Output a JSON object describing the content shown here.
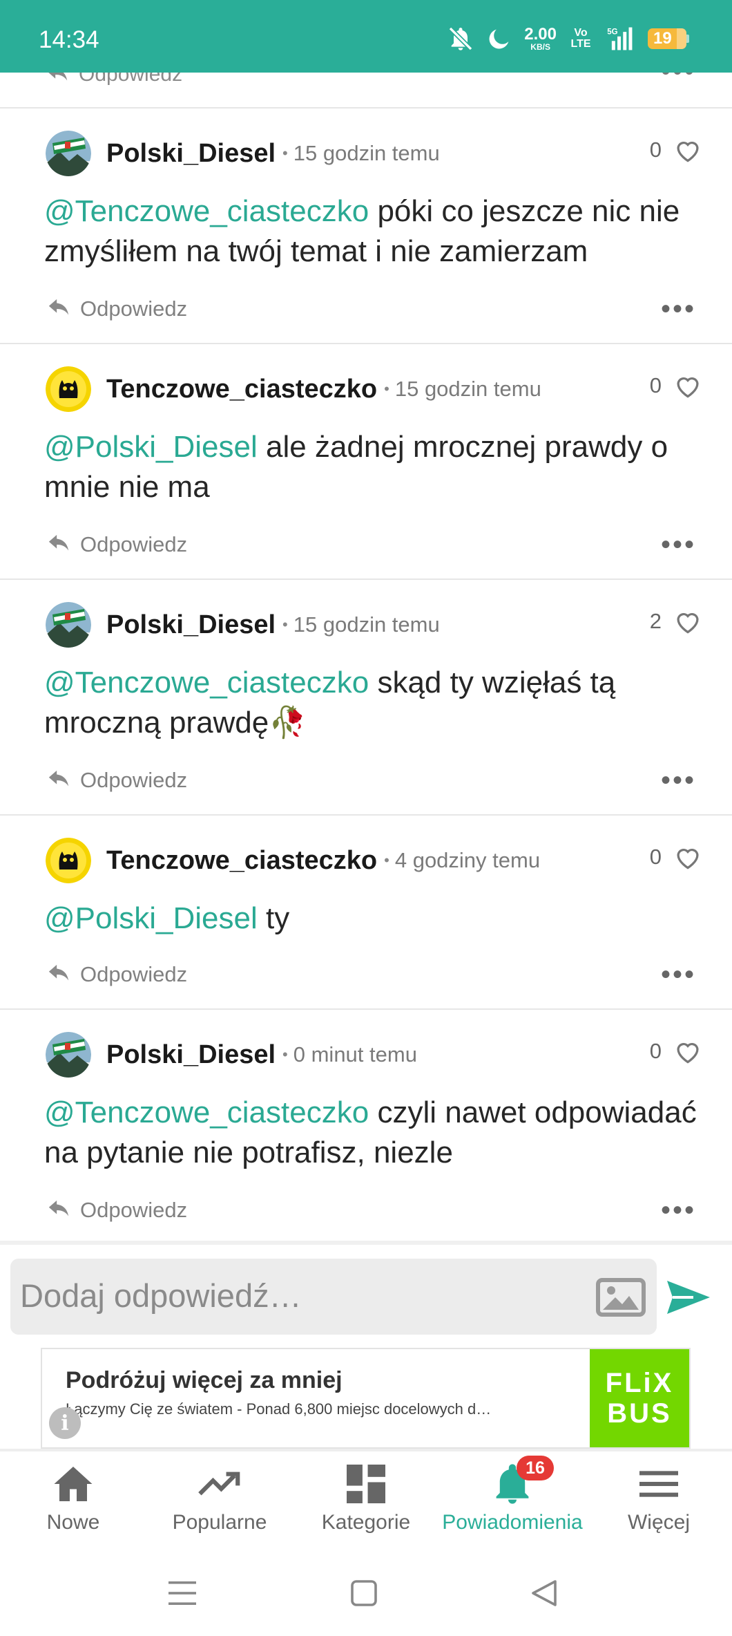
{
  "status_bar": {
    "time": "14:34",
    "net_speed": "2.00",
    "net_unit": "KB/S",
    "volte": "Vo LTE",
    "network": "5G",
    "battery": "19",
    "icons": [
      "bell-muted-icon",
      "moon-icon",
      "signal-icon",
      "battery-icon"
    ]
  },
  "previous_comment": {
    "reply_label": "Odpowiedz"
  },
  "comments": [
    {
      "author": "Polski_Diesel",
      "time": "15 godzin temu",
      "likes": "0",
      "mention": "@Tenczowe_ciasteczko",
      "text": " póki co jeszcze nic nie zmyśliłem na twój temat i nie zamierzam",
      "reply_label": "Odpowiedz",
      "avatar": "scarf-avatar"
    },
    {
      "author": "Tenczowe_ciasteczko",
      "time": "15 godzin temu",
      "likes": "0",
      "mention": "@Polski_Diesel",
      "text": " ale żadnej mrocznej prawdy o mnie nie ma",
      "reply_label": "Odpowiedz",
      "avatar": "cat-avatar"
    },
    {
      "author": "Polski_Diesel",
      "time": "15 godzin temu",
      "likes": "2",
      "mention": "@Tenczowe_ciasteczko",
      "text": " skąd ty wzięłaś tą mroczną prawdę🥀",
      "reply_label": "Odpowiedz",
      "avatar": "scarf-avatar"
    },
    {
      "author": "Tenczowe_ciasteczko",
      "time": "4 godziny temu",
      "likes": "0",
      "mention": "@Polski_Diesel",
      "text": " ty",
      "reply_label": "Odpowiedz",
      "avatar": "cat-avatar"
    },
    {
      "author": "Polski_Diesel",
      "time": "0 minut temu",
      "likes": "0",
      "mention": "@Tenczowe_ciasteczko",
      "text": " czyli nawet odpowiadać na pytanie nie potrafisz, niezle",
      "reply_label": "Odpowiedz",
      "avatar": "scarf-avatar"
    }
  ],
  "composer": {
    "placeholder": "Dodaj odpowiedź…"
  },
  "ad": {
    "title": "Podróżuj więcej za mniej",
    "description": "Łączymy Cię ze światem - Ponad 6,800 miejsc docelowych d…",
    "logo_line1": "FLiX",
    "logo_line2": "BUS",
    "logo_color": "#73d700"
  },
  "bottom_nav": {
    "items": [
      {
        "label": "Nowe",
        "icon": "home-icon"
      },
      {
        "label": "Popularne",
        "icon": "trending-icon"
      },
      {
        "label": "Kategorie",
        "icon": "grid-icon"
      },
      {
        "label": "Powiadomienia",
        "icon": "bell-icon",
        "badge": "16",
        "active": true
      },
      {
        "label": "Więcej",
        "icon": "menu-icon"
      }
    ]
  },
  "colors": {
    "accent": "#2aae98",
    "mention": "#2aa993",
    "badge": "#e53935"
  }
}
